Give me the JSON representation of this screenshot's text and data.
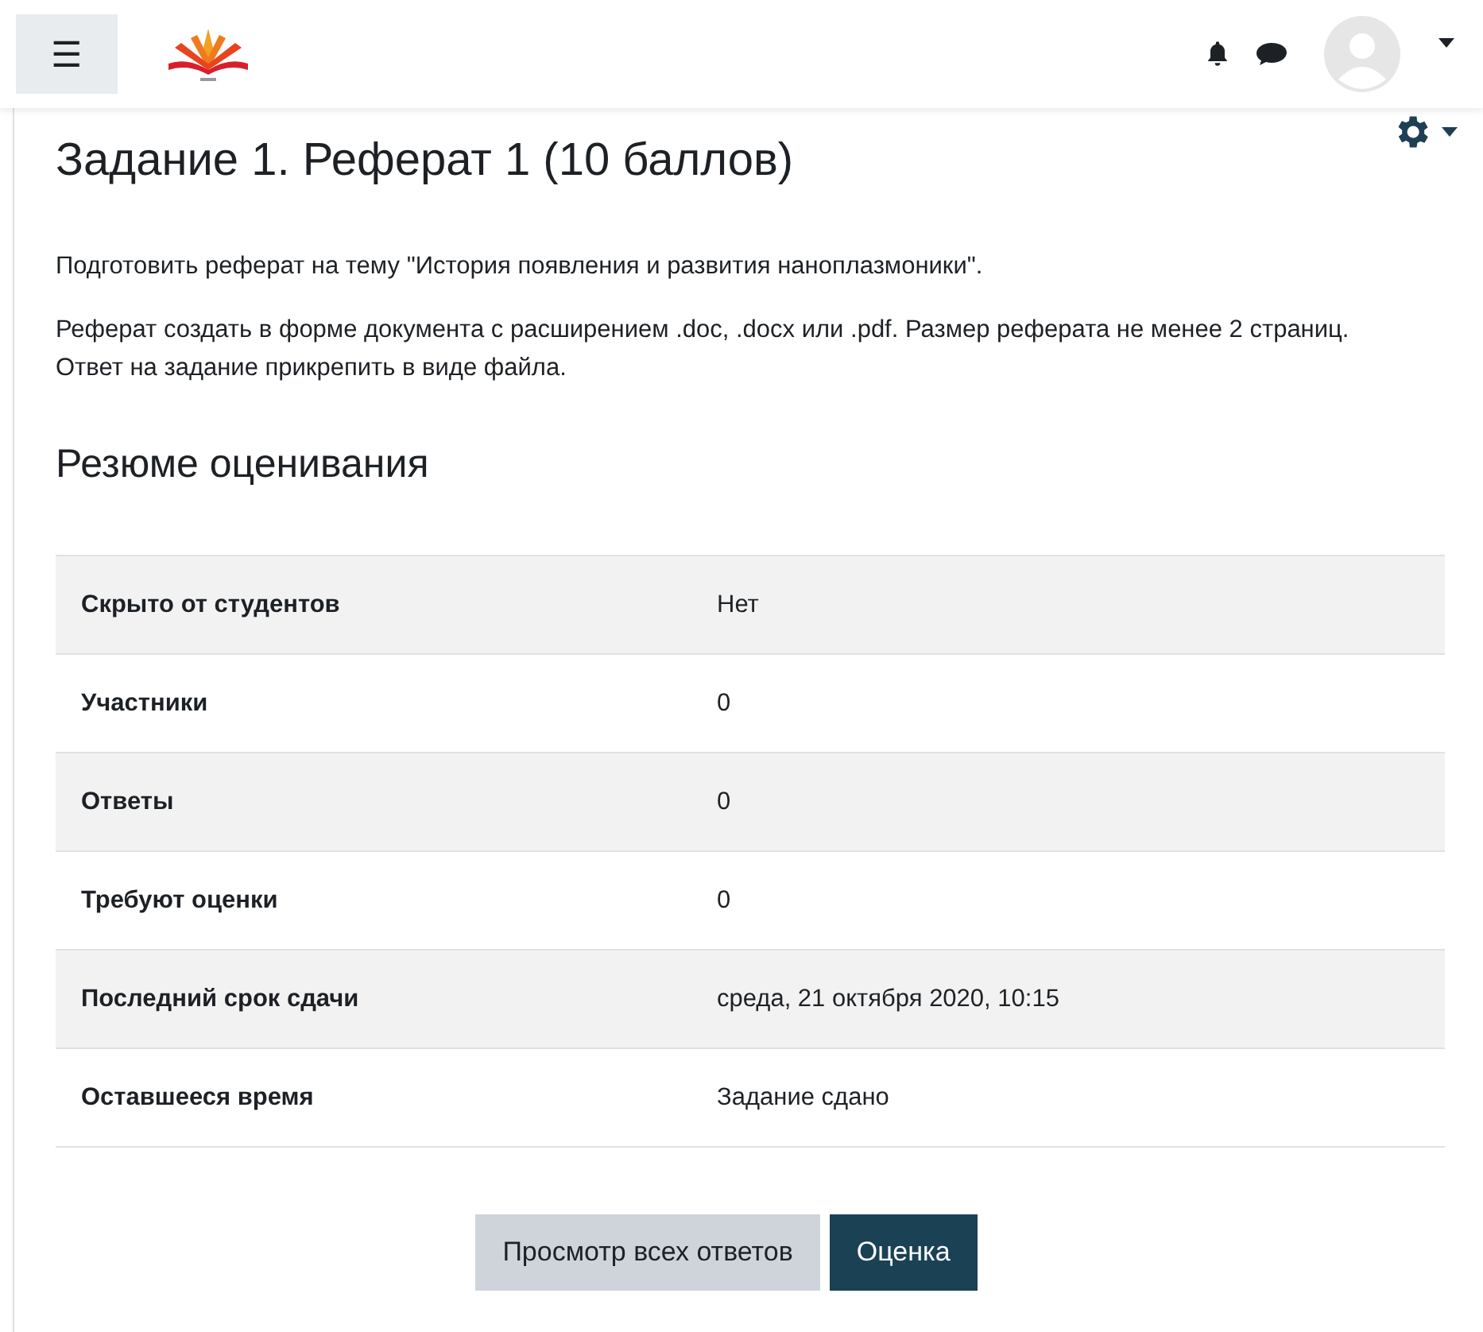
{
  "header": {
    "menu_button": "☰"
  },
  "page": {
    "title": "Задание 1. Реферат 1 (10 баллов)",
    "paragraphs": [
      "Подготовить реферат на тему \"История появления и развития наноплазмоники\".",
      "Реферат создать в форме документа с расширением .doc, .docx  или .pdf. Размер реферата не менее 2 страниц. Ответ на задание прикрепить в виде файла."
    ],
    "section_title": "Резюме оценивания",
    "table": {
      "rows": [
        {
          "label": "Скрыто от студентов",
          "value": "Нет"
        },
        {
          "label": "Участники",
          "value": "0"
        },
        {
          "label": "Ответы",
          "value": "0"
        },
        {
          "label": "Требуют оценки",
          "value": "0"
        },
        {
          "label": "Последний срок сдачи",
          "value": "среда, 21 октября 2020, 10:15"
        },
        {
          "label": "Оставшееся время",
          "value": "Задание сдано"
        }
      ]
    },
    "buttons": [
      {
        "label": "Просмотр всех ответов",
        "kind": "secondary"
      },
      {
        "label": "Оценка",
        "kind": "primary"
      }
    ]
  }
}
